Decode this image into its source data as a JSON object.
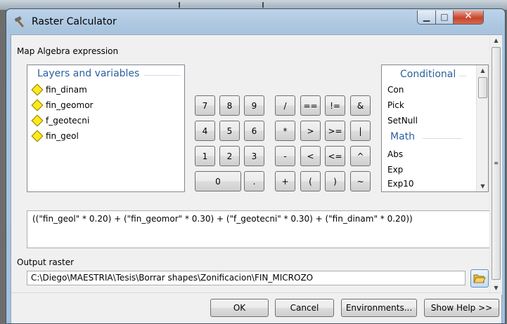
{
  "window": {
    "title": "Raster Calculator"
  },
  "expression_label": "Map Algebra expression",
  "layers": {
    "header": "Layers and variables",
    "items": [
      "fin_dinam",
      "fin_geomor",
      "f_geotecni",
      "fin_geol"
    ]
  },
  "keypad": {
    "row1": [
      "7",
      "8",
      "9",
      "/",
      "==",
      "!=",
      "&"
    ],
    "row2": [
      "4",
      "5",
      "6",
      "*",
      ">",
      ">=",
      "|"
    ],
    "row3": [
      "1",
      "2",
      "3",
      "-",
      "<",
      "<=",
      "^"
    ],
    "row4": [
      "0",
      ".",
      "+",
      "(",
      ")",
      "~"
    ]
  },
  "functions": {
    "conditional_header": "Conditional",
    "conditional": [
      "Con",
      "Pick",
      "SetNull"
    ],
    "math_header": "Math",
    "math": [
      "Abs",
      "Exp",
      "Exp10"
    ]
  },
  "expression": "((\"fin_geol\" * 0.20) + (\"fin_geomor\" * 0.30) + (\"f_geotecni\" * 0.30) + (\"fin_dinam\" * 0.20))",
  "output": {
    "label": "Output raster",
    "value": "C:\\Diego\\MAESTRIA\\Tesis\\Borrar shapes\\Zonificacion\\FIN_MICROZO"
  },
  "buttons": {
    "ok": "OK",
    "cancel": "Cancel",
    "environments": "Environments...",
    "help": "Show Help >>"
  },
  "icons": {
    "app": "hammer-icon",
    "minimize": "minimize-icon",
    "maximize": "maximize-icon",
    "close": "close-icon",
    "layer": "raster-layer-icon",
    "browse": "folder-open-icon"
  },
  "colors": {
    "group_title": "#2c5f9e",
    "layer_icon": "#ffe91c",
    "close_button": "#c8442c"
  }
}
